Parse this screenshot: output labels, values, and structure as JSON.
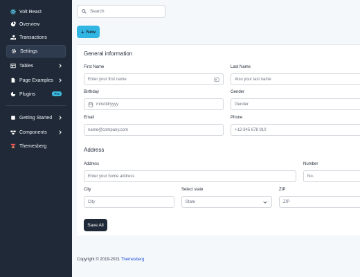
{
  "sidebar": {
    "brand": "Volt React",
    "items": [
      {
        "label": "Overview",
        "icon": "pie-chart-icon"
      },
      {
        "label": "Transactions",
        "icon": "hand-holding-usd-icon"
      },
      {
        "label": "Settings",
        "icon": "gear-icon",
        "active": true
      },
      {
        "label": "Tables",
        "icon": "table-icon"
      },
      {
        "label": "Page Examples",
        "icon": "file-icon"
      },
      {
        "label": "Plugins",
        "icon": "chart-pie-icon",
        "badge": "Pro"
      },
      {
        "label": "Getting Started",
        "icon": "book-icon"
      },
      {
        "label": "Components",
        "icon": "boxes-icon"
      },
      {
        "label": "Themesberg",
        "icon": "themesberg-logo-icon"
      }
    ]
  },
  "search": {
    "placeholder": "Search"
  },
  "new_button": {
    "label": "New"
  },
  "general": {
    "title": "General information",
    "first_name": {
      "label": "First Name",
      "placeholder": "Enter your first name"
    },
    "last_name": {
      "label": "Last Name",
      "placeholder": "Also your last name"
    },
    "birthday": {
      "label": "Birthday",
      "placeholder": "mm/dd/yyyy"
    },
    "gender": {
      "label": "Gender",
      "value": "Gender"
    },
    "email": {
      "label": "Email",
      "placeholder": "name@company.com"
    },
    "phone": {
      "label": "Phone",
      "placeholder": "+12-345 678 910"
    }
  },
  "address": {
    "title": "Address",
    "address": {
      "label": "Address",
      "placeholder": "Enter your home address"
    },
    "number": {
      "label": "Number",
      "placeholder": "No."
    },
    "city": {
      "label": "City",
      "placeholder": "City"
    },
    "state": {
      "label": "Select state",
      "value": "State"
    },
    "zip": {
      "label": "ZIP",
      "placeholder": "ZIP"
    }
  },
  "save_button": {
    "label": "Save All"
  },
  "footer": {
    "text": "Copyright © 2019-2021 ",
    "link": "Themesberg"
  },
  "colors": {
    "sidebar_bg": "#1f2937",
    "accent": "#31b6e3",
    "badge": "#3abde0"
  }
}
